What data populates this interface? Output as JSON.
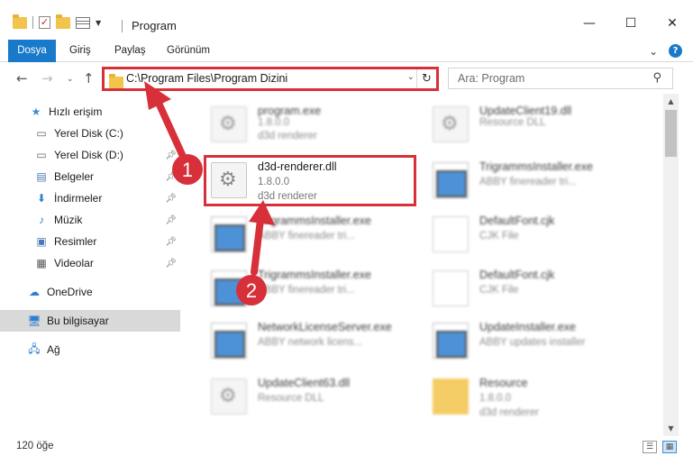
{
  "window": {
    "title": "Program",
    "controls": {
      "minimize": "—",
      "maximize": "☐",
      "close": "✕"
    }
  },
  "ribbon": {
    "tabs": [
      {
        "label": "Dosya",
        "active": true
      },
      {
        "label": "Giriş"
      },
      {
        "label": "Paylaş"
      },
      {
        "label": "Görünüm"
      }
    ]
  },
  "address": {
    "path": "C:\\Program Files\\Program Dizini"
  },
  "search": {
    "placeholder": "Ara: Program"
  },
  "sidebar": {
    "items": [
      {
        "label": "Hızlı erişim",
        "icon": "star-icon"
      },
      {
        "label": "Yerel Disk (C:)",
        "icon": "drive-icon"
      },
      {
        "label": "Yerel Disk (D:)",
        "icon": "drive-icon",
        "pinned": true
      },
      {
        "label": "Belgeler",
        "icon": "documents-icon",
        "pinned": true
      },
      {
        "label": "İndirmeler",
        "icon": "download-icon",
        "pinned": true
      },
      {
        "label": "Müzik",
        "icon": "music-icon",
        "pinned": true
      },
      {
        "label": "Resimler",
        "icon": "pictures-icon",
        "pinned": true
      },
      {
        "label": "Videolar",
        "icon": "videos-icon",
        "pinned": true
      },
      {
        "label": "OneDrive",
        "icon": "cloud-icon"
      },
      {
        "label": "Bu bilgisayar",
        "icon": "computer-icon",
        "selected": true
      },
      {
        "label": "Ağ",
        "icon": "network-icon"
      }
    ]
  },
  "files": [
    {
      "name": "program.exe",
      "version": "1.8.0.0",
      "desc": "d3d renderer",
      "icon": "gear-icon"
    },
    {
      "name": "UpdateClient19.dll",
      "version": "Resource DLL",
      "desc": "",
      "icon": "gear-icon"
    },
    {
      "name": "d3d-renderer.dll",
      "version": "1.8.0.0",
      "desc": "d3d renderer",
      "icon": "gear-icon",
      "highlighted": true
    },
    {
      "name": "TrigrammsInstaller.exe",
      "version": "ABBY finereader tri...",
      "desc": "",
      "icon": "app-icon"
    },
    {
      "name": "TrigrammsInstaller.exe",
      "version": "ABBY finereader tri...",
      "desc": "",
      "icon": "app-icon"
    },
    {
      "name": "DefaultFont.cjk",
      "version": "CJK File",
      "desc": "",
      "icon": "doc-icon"
    },
    {
      "name": "TrigrammsInstaller.exe",
      "version": "ABBY finereader tri...",
      "desc": "",
      "icon": "app-icon"
    },
    {
      "name": "DefaultFont.cjk",
      "version": "CJK File",
      "desc": "",
      "icon": "doc-icon"
    },
    {
      "name": "NetworkLicenseServer.exe",
      "version": "ABBY network licens...",
      "desc": "",
      "icon": "app-icon"
    },
    {
      "name": "UpdateInstaller.exe",
      "version": "ABBY updates installer",
      "desc": "",
      "icon": "app-icon"
    },
    {
      "name": "UpdateClient63.dll",
      "version": "Resource DLL",
      "desc": "",
      "icon": "gear-icon"
    },
    {
      "name": "Resource",
      "version": "1.8.0.0",
      "desc": "d3d renderer",
      "icon": "folder-icon"
    }
  ],
  "status": {
    "count": "120 öğe"
  },
  "annotations": {
    "step1": "1",
    "step2": "2",
    "color": "#d8303a"
  }
}
